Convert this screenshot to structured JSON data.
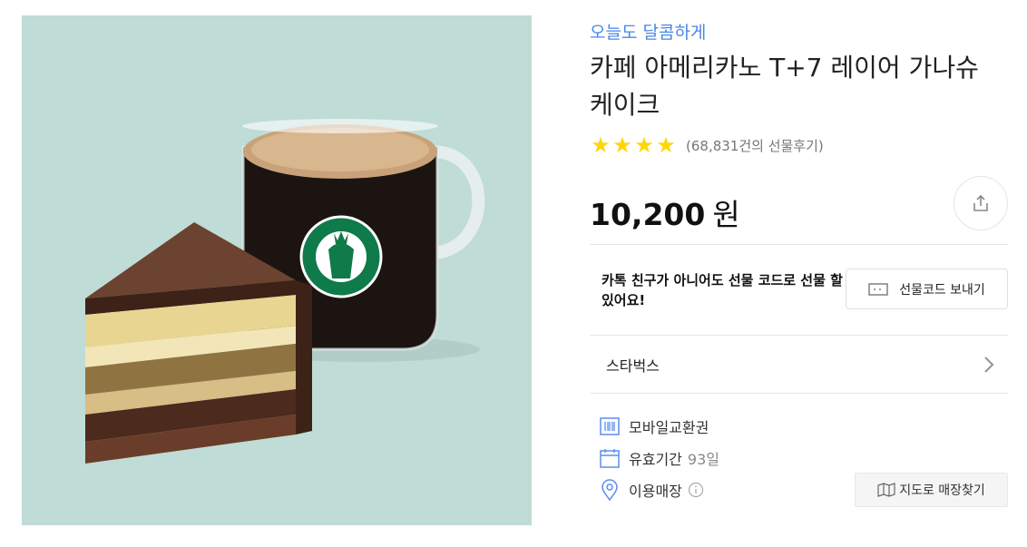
{
  "product": {
    "promo": "오늘도 달콤하게",
    "title": "카페 아메리카노 T+7 레이어 가나슈 케이크",
    "rating": {
      "stars": 4,
      "review_count": "(68,831건의 선물후기)"
    },
    "price": {
      "amount": "10,200",
      "unit": "원"
    },
    "image_logo_text": "STARBUCKS"
  },
  "gift": {
    "message": "카톡 친구가 아니어도 선물 코드로 선물 할 수 있어요!",
    "button_label": "선물코드 보내기"
  },
  "brand": {
    "name": "스타벅스"
  },
  "meta": {
    "type_label": "모바일교환권",
    "validity_label": "유효기간",
    "validity_value": "93일",
    "store_label": "이용매장",
    "map_button_label": "지도로 매장찾기"
  },
  "icons": {
    "star": "star-icon",
    "share": "share-icon",
    "ticket": "gift-code-icon",
    "chevron": "chevron-right-icon",
    "voucher": "barcode-icon",
    "calendar": "calendar-icon",
    "location": "location-pin-icon",
    "info": "info-icon",
    "map": "map-icon"
  },
  "colors": {
    "accent": "#4a86e8",
    "star": "#ffd600",
    "image_background": "#bfdcd6",
    "icon_blue": "#5b8def"
  }
}
